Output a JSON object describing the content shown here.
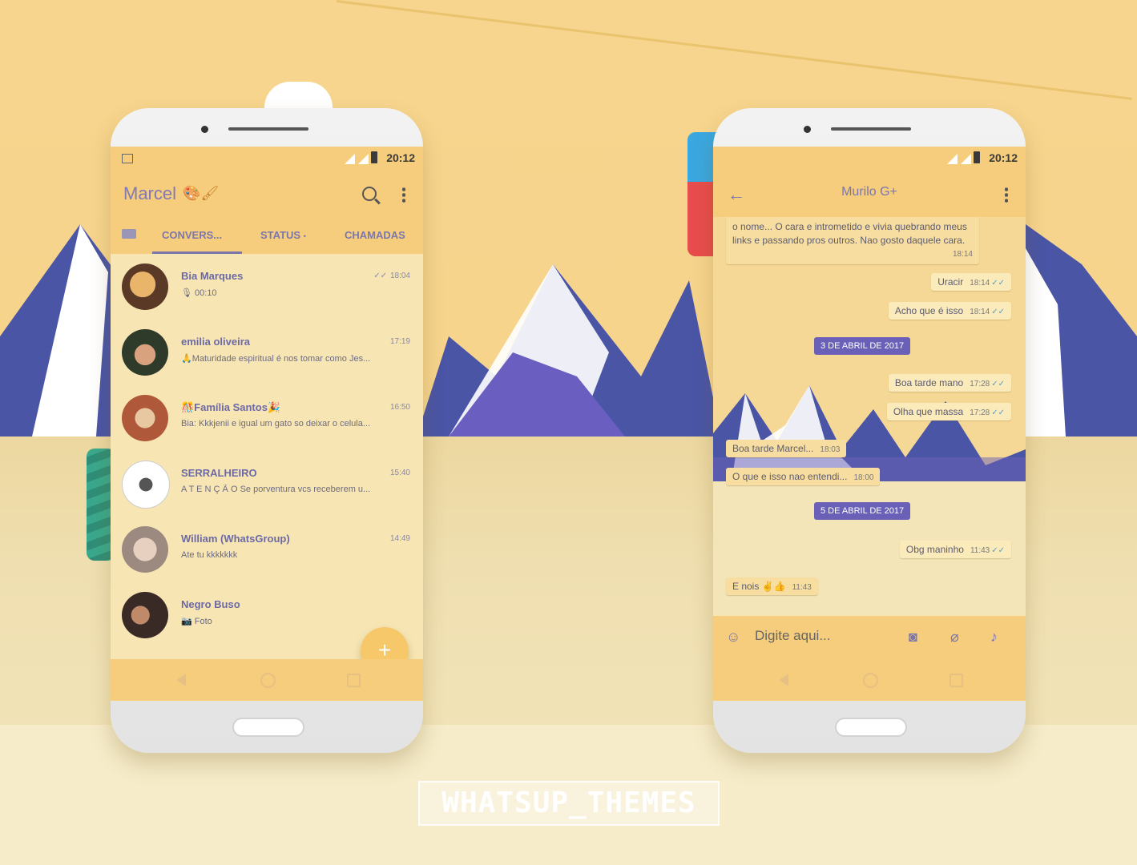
{
  "watermark": "WHATSUP_THEMES",
  "left_phone": {
    "status_time": "20:12",
    "app_title": "Marcel",
    "app_title_emoji": "🎨🖌",
    "tabs": [
      "CONVERS...",
      "STATUS",
      "CHAMADAS"
    ],
    "status_tab_dot": "•",
    "fab_label": "+",
    "chats": [
      {
        "name": "Bia Marques",
        "preview": "🎙 00:10",
        "time": "18:04",
        "ticks": "✓✓"
      },
      {
        "name": "emilia oliveira",
        "preview": "🙏Maturidade espiritual é nos tomar como Jes...",
        "time": "17:19"
      },
      {
        "name": "🎊Família Santos🎉",
        "preview": "Bia: Kkkjenii e igual um gato  so deixar o celula...",
        "time": "16:50"
      },
      {
        "name": "SERRALHEIRO",
        "preview": "A T E N Ç Ã O  Se porventura vcs receberem u...",
        "time": "15:40"
      },
      {
        "name": "William (WhatsGroup)",
        "preview": "Ate tu kkkkkkk",
        "time": "14:49"
      },
      {
        "name": "Negro Buso",
        "preview": "📷 Foto",
        "time": ""
      }
    ]
  },
  "right_phone": {
    "status_time": "20:12",
    "contact_name": "Murilo G+",
    "back_icon": "←",
    "input_placeholder": "Digite aqui...",
    "messages": [
      {
        "text": "o nome... O cara e intrometido e vivia quebrando meus links e passando pros outros. Nao gosto daquele cara.",
        "time": "18:14",
        "dir": "in"
      },
      {
        "text": "Uracir",
        "time": "18:14",
        "dir": "out"
      },
      {
        "text": "Acho que é isso",
        "time": "18:14",
        "dir": "out"
      },
      {
        "date": "3 DE ABRIL DE 2017"
      },
      {
        "text": "Boa tarde mano",
        "time": "17:28",
        "dir": "out"
      },
      {
        "text": "Olha que massa",
        "time": "17:28",
        "dir": "out"
      },
      {
        "text": "Boa tarde Marcel...",
        "time": "18:03",
        "dir": "in"
      },
      {
        "text": "O que e isso nao entendi...",
        "time": "18:00",
        "dir": "in"
      },
      {
        "date": "5 DE ABRIL DE 2017"
      },
      {
        "text": "Obg maninho",
        "time": "11:43",
        "dir": "out"
      },
      {
        "text": "E nois ✌👍",
        "time": "11:43",
        "dir": "in"
      }
    ]
  },
  "colors": {
    "bar": "#f6cd7c",
    "accent": "#7b76ad",
    "date_chip": "#6a60b8",
    "list_bg": "#f7e6b4"
  }
}
